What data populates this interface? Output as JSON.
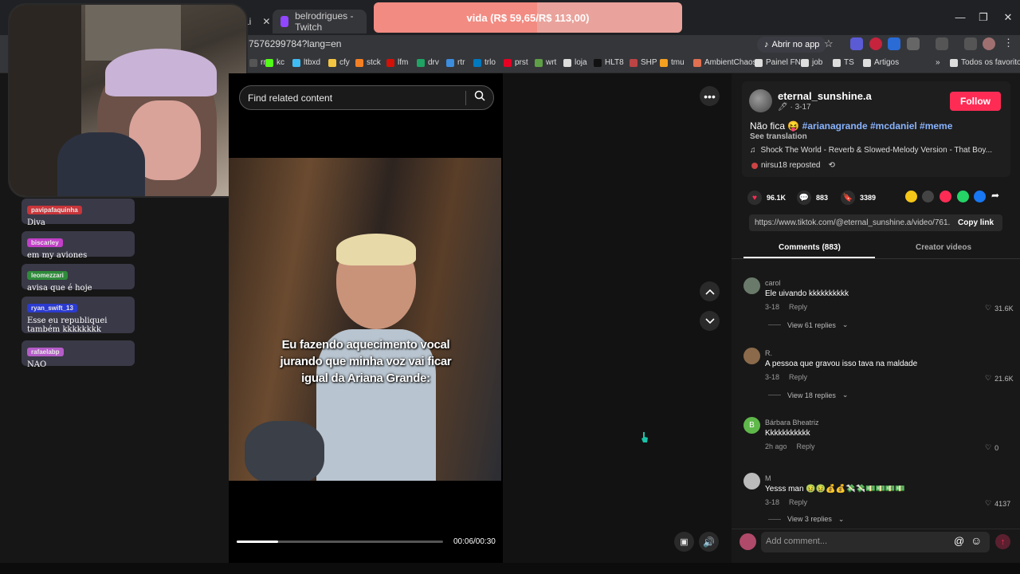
{
  "browser": {
    "tab_partial": "Li",
    "tab_title": "belrodrigues - Twitch",
    "url": "7576299784?lang=en",
    "open_app_label": "Abrir no app",
    "window_controls": [
      "—",
      "❐",
      "✕"
    ]
  },
  "bookmarks": [
    {
      "label": "rnt",
      "color": "#555"
    },
    {
      "label": "kc",
      "color": "#53fc18"
    },
    {
      "label": "ltbxd",
      "color": "#40bcf4"
    },
    {
      "label": "cfy",
      "color": "#f4c542"
    },
    {
      "label": "stck",
      "color": "#f48024"
    },
    {
      "label": "lfm",
      "color": "#d51007"
    },
    {
      "label": "drv",
      "color": "#1fa463"
    },
    {
      "label": "rtr",
      "color": "#3c8dde"
    },
    {
      "label": "trlo",
      "color": "#0079bf"
    },
    {
      "label": "prst",
      "color": "#e60023"
    },
    {
      "label": "wrt",
      "color": "#5fa046"
    },
    {
      "label": "loja",
      "color": "#ddd"
    },
    {
      "label": "HLT8",
      "color": "#111"
    },
    {
      "label": "SHP",
      "color": "#b44"
    },
    {
      "label": "tmu",
      "color": "#f4a020"
    },
    {
      "label": "AmbientChaos",
      "color": "#e07050"
    },
    {
      "label": "Painel FN",
      "color": "#ddd"
    },
    {
      "label": "job",
      "color": "#ddd"
    },
    {
      "label": "TS",
      "color": "#ddd"
    },
    {
      "label": "Artigos",
      "color": "#ddd"
    },
    {
      "label": "»",
      "color": "transparent"
    },
    {
      "label": "Todos os favoritos",
      "color": "#ddd"
    }
  ],
  "goal_banner": "vida (R$ 59,65/R$ 113,00)",
  "chat": [
    {
      "user": "pavipafaquinha",
      "user_color": "#c8353a",
      "text": "Diva"
    },
    {
      "user": "biscarley",
      "user_color": "#c23fc8",
      "text": "em my aviones"
    },
    {
      "user": "leomezzari",
      "user_color": "#2e8b3a",
      "text": "avisa que é hoje"
    },
    {
      "user": "ryan_swift_13",
      "user_color": "#2b3bd0",
      "text": "Esse eu republiquei também kkkkkkkk"
    },
    {
      "user": "rafaelabp",
      "user_color": "#b55cc9",
      "text": "NAO"
    }
  ],
  "search": {
    "placeholder": "Find related content"
  },
  "video": {
    "subtitle": "Eu fazendo aquecimento vocal jurando que minha voz vai ficar igual da Ariana Grande:",
    "timecode": "00:06/00:30",
    "progress": 0.2
  },
  "post": {
    "username": "eternal_sunshine.a",
    "date": "· 3-17",
    "follow_label": "Follow",
    "caption_text": "Não fica 😝",
    "hashtags": "#arianagrande #mcdaniel #meme",
    "see_translation": "See translation",
    "music": "Shock The World - Reverb & Slowed-Melody Version - That Boy...",
    "reposted": "nirsu18 reposted",
    "likes": "96.1K",
    "comments": "883",
    "saves": "3389",
    "link": "https://www.tiktok.com/@eternal_sunshine.a/video/761...",
    "copy_link": "Copy link",
    "tab_comments": "Comments (883)",
    "tab_creator": "Creator videos"
  },
  "comments": [
    {
      "name": "carol",
      "text": "Ele uivando kkkkkkkkkk",
      "date": "3-18",
      "reply": "Reply",
      "likes": "31.6K",
      "replies": "View 61 replies",
      "avatar_color": "#6a7a6a"
    },
    {
      "name": "R.",
      "text": "A pessoa que gravou isso tava na maldade",
      "date": "3-18",
      "reply": "Reply",
      "likes": "21.6K",
      "replies": "View 18 replies",
      "avatar_color": "#8a6a4a"
    },
    {
      "name": "Bárbara Bheatriz",
      "text": "Kkkkkkkkkkk",
      "date": "2h ago",
      "reply": "Reply",
      "likes": "0",
      "replies": "",
      "avatar_color": "#5fb84a",
      "avatar_letter": "B"
    },
    {
      "name": "M",
      "text": "Yesss man 🤢🤢💰💰💸💸💵💵💵💵",
      "date": "3-18",
      "reply": "Reply",
      "likes": "4137",
      "replies": "View 3 replies",
      "avatar_color": "#bbbbbb"
    }
  ],
  "comment_input": {
    "placeholder": "Add comment..."
  }
}
